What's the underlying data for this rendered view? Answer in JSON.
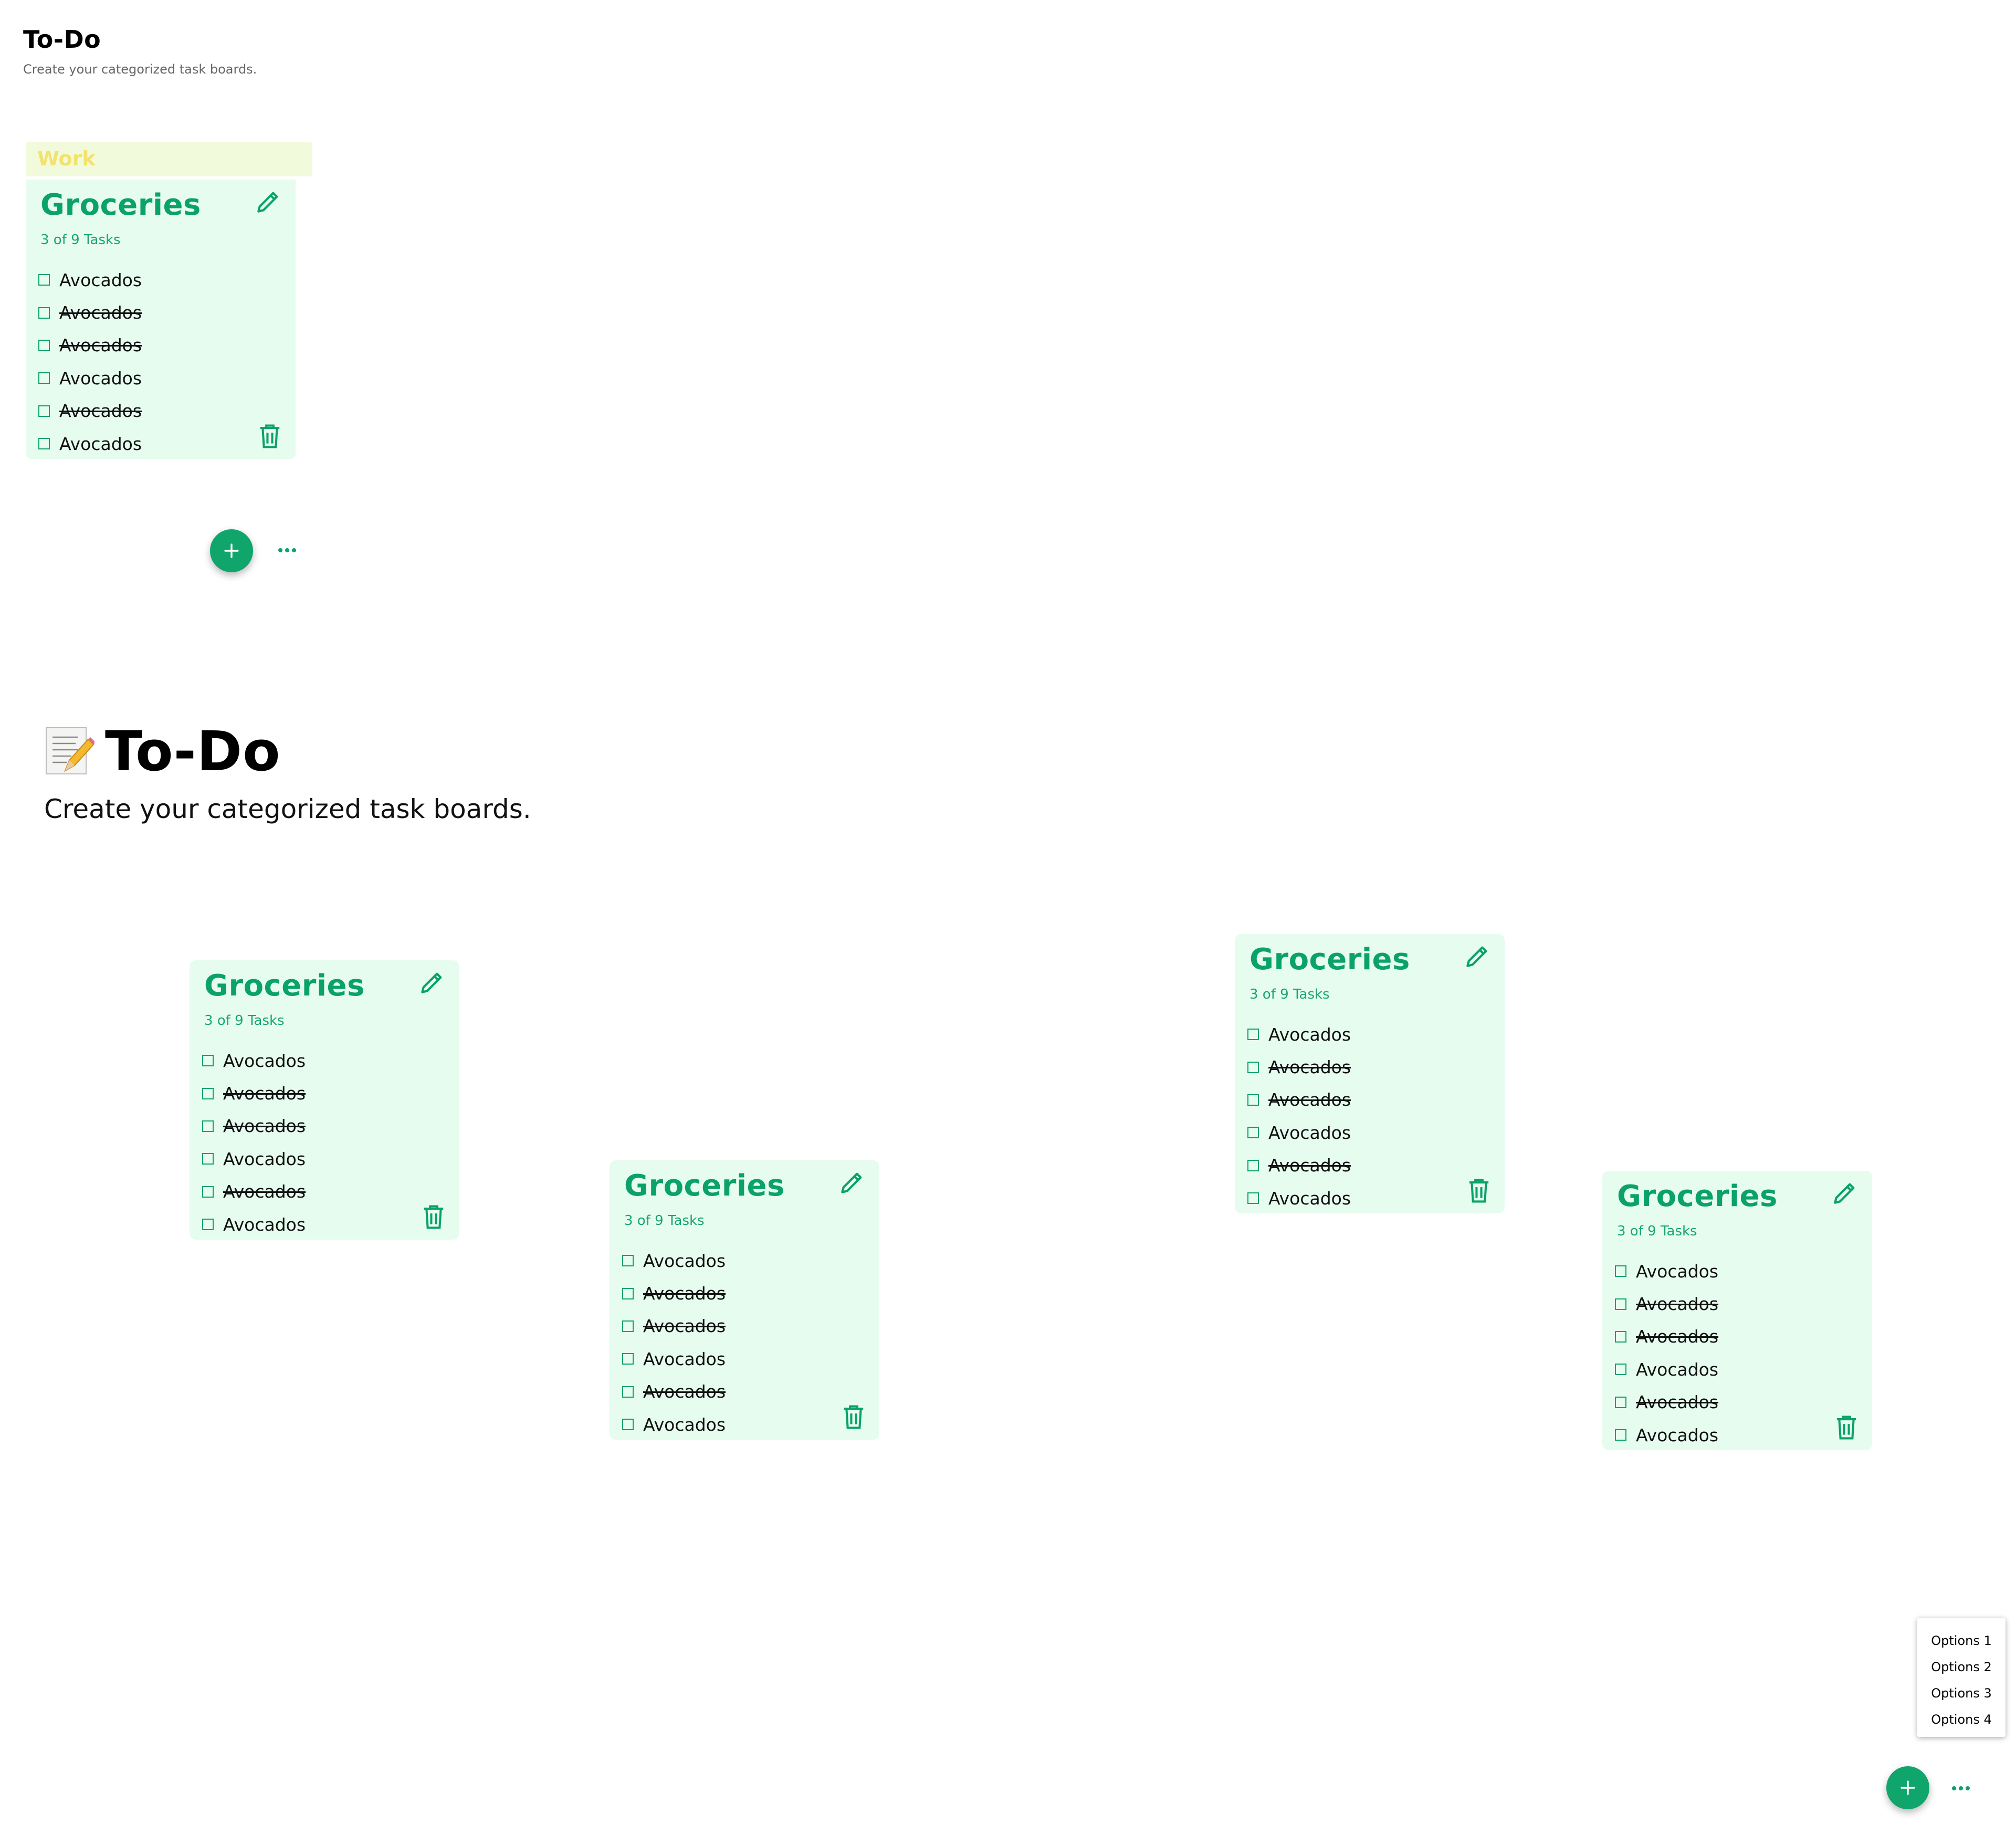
{
  "header_small": {
    "title": "To-Do",
    "subtitle": "Create your categorized task boards."
  },
  "header_large": {
    "emoji_icon": "memo-pencil-icon",
    "title": "To-Do",
    "subtitle": "Create your categorized task boards."
  },
  "category_tag": "Work",
  "board": {
    "title": "Groceries",
    "count": "3 of 9 Tasks",
    "tasks": [
      {
        "label": "Avocados",
        "done": false
      },
      {
        "label": "Avocados",
        "done": true
      },
      {
        "label": "Avocados",
        "done": true
      },
      {
        "label": "Avocados",
        "done": false
      },
      {
        "label": "Avocados",
        "done": true
      },
      {
        "label": "Avocados",
        "done": false
      }
    ]
  },
  "options_menu": [
    "Options 1",
    "Options 2",
    "Options 3",
    "Options 4"
  ],
  "colors": {
    "accent": "#0aa269",
    "card_bg": "#e6fcef",
    "tag_bg": "#f1fbdc",
    "tag_text": "#f3e26e"
  }
}
